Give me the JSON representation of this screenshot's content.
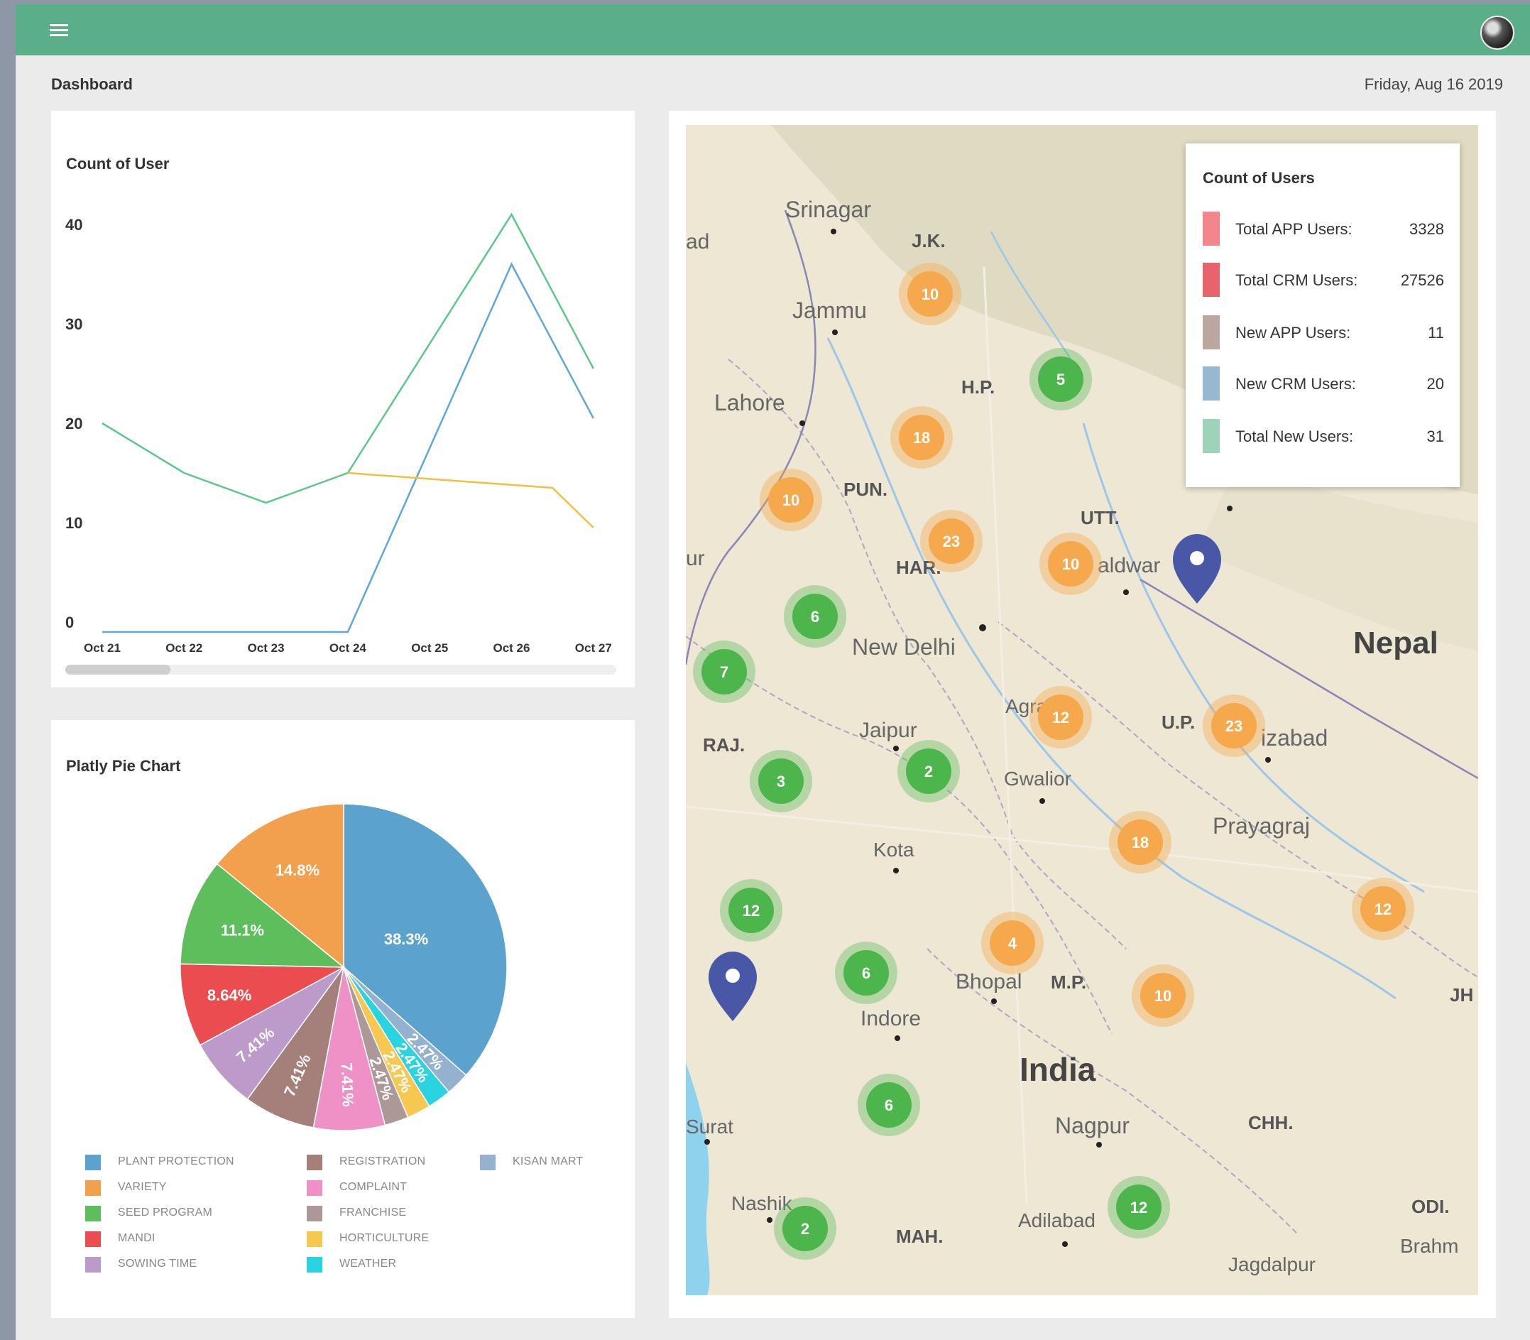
{
  "header": {
    "menu_icon": "hamburger-icon",
    "avatar_icon": "user-avatar-icon"
  },
  "page": {
    "title": "Dashboard",
    "date": "Friday, Aug 16 2019"
  },
  "line_chart": {
    "chart_data": {
      "type": "line",
      "title": "Count of User",
      "x": [
        "Oct 21",
        "Oct 22",
        "Oct 23",
        "Oct 24",
        "Oct 25",
        "Oct 26",
        "Oct 27"
      ],
      "y_ticks": [
        "40",
        "30",
        "20",
        "10",
        "0"
      ],
      "ylim": [
        0,
        40
      ],
      "series": [
        {
          "color": "#5bc888",
          "x": [
            "Oct 21",
            "Oct 22",
            "Oct 23",
            "Oct 24",
            "Oct 26",
            "Oct 27"
          ],
          "values": [
            20,
            15,
            12,
            15,
            41,
            25.5
          ]
        },
        {
          "color": "#5da8d8",
          "x": [
            "Oct 21",
            "Oct 22",
            "Oct 23",
            "Oct 24",
            "Oct 26",
            "Oct 27"
          ],
          "values": [
            -1,
            -1,
            -1,
            -1,
            36,
            20.5
          ]
        },
        {
          "color": "#f2c03e",
          "x": [
            "Oct 24",
            "Oct 26.5",
            "Oct 27"
          ],
          "values": [
            15,
            13.5,
            9.5
          ]
        }
      ],
      "grid": false
    }
  },
  "pie_chart": {
    "chart_data": {
      "type": "pie",
      "title": "Platly Pie Chart",
      "slices": [
        {
          "label": "PLANT PROTECTION",
          "value": 38.3,
          "text": "38.3%",
          "color": "#5ba3ce"
        },
        {
          "label": "KISAN MART",
          "value": 2.47,
          "text": "2.47%",
          "color": "#94b1cf"
        },
        {
          "label": "WEATHER",
          "value": 2.47,
          "text": "2.47%",
          "color": "#2bd3e0"
        },
        {
          "label": "HORTICULTURE",
          "value": 2.47,
          "text": "2.47%",
          "color": "#f6c850"
        },
        {
          "label": "FRANCHISE",
          "value": 2.47,
          "text": "2.47%",
          "color": "#ac9896"
        },
        {
          "label": "COMPLAINT",
          "value": 7.41,
          "text": "7.41%",
          "color": "#ef90c6"
        },
        {
          "label": "REGISTRATION",
          "value": 7.41,
          "text": "7.41%",
          "color": "#a5807b"
        },
        {
          "label": "SOWING TIME",
          "value": 7.41,
          "text": "7.41%",
          "color": "#bc9ac9"
        },
        {
          "label": "MANDI",
          "value": 8.64,
          "text": "8.64%",
          "color": "#ea4c50"
        },
        {
          "label": "SEED PROGRAM",
          "value": 11.1,
          "text": "11.1%",
          "color": "#5cbf5c"
        },
        {
          "label": "VARIETY",
          "value": 14.8,
          "text": "14.8%",
          "color": "#f29f4e"
        }
      ],
      "legend_placement": "bottom",
      "legend": [
        {
          "label": "PLANT PROTECTION",
          "color": "#5ba3ce"
        },
        {
          "label": "VARIETY",
          "color": "#f29f4e"
        },
        {
          "label": "SEED PROGRAM",
          "color": "#5cbf5c"
        },
        {
          "label": "MANDI",
          "color": "#ea4c50"
        },
        {
          "label": "SOWING TIME",
          "color": "#bc9ac9"
        },
        {
          "label": "REGISTRATION",
          "color": "#a5807b"
        },
        {
          "label": "COMPLAINT",
          "color": "#ef90c6"
        },
        {
          "label": "FRANCHISE",
          "color": "#ac9896"
        },
        {
          "label": "HORTICULTURE",
          "color": "#f6c850"
        },
        {
          "label": "WEATHER",
          "color": "#2bd3e0"
        },
        {
          "label": "KISAN MART",
          "color": "#94b1cf"
        }
      ]
    }
  },
  "map": {
    "place_labels": [
      "Srinagar",
      "J.K.",
      "Jammu",
      "H.P.",
      "Lahore",
      "PUN.",
      "UTT.",
      "HAR.",
      "New Delhi",
      "Nepal",
      "Jaipur",
      "U.P.",
      "RAJ.",
      "Gwalior",
      "Prayagraj",
      "Kota",
      "Bhopal",
      "M.P.",
      "Indore",
      "India",
      "Nagpur",
      "CHH.",
      "Surat",
      "Nashik",
      "MAH.",
      "Adilabad",
      "Jagdalpur",
      "ODI.",
      "Brahm",
      "JH",
      "Agra",
      "izabad",
      "aldwar",
      "ad",
      "ur"
    ],
    "orange_clusters": [
      "10",
      "18",
      "10",
      "23",
      "10",
      "12",
      "23",
      "18",
      "12",
      "4",
      "10"
    ],
    "green_clusters": [
      "5",
      "6",
      "7",
      "3",
      "2",
      "12",
      "6",
      "6",
      "12",
      "2"
    ],
    "pin_icon": "map-pin-icon",
    "info": {
      "title": "Count of Users",
      "rows": [
        {
          "label": "Total APP Users:",
          "value": "3328",
          "color": "#f2868c"
        },
        {
          "label": "Total CRM Users:",
          "value": "27526",
          "color": "#e9636c"
        },
        {
          "label": "New APP Users:",
          "value": "11",
          "color": "#bba6a0"
        },
        {
          "label": "New CRM Users:",
          "value": "20",
          "color": "#98b7d0"
        },
        {
          "label": "Total New Users:",
          "value": "31",
          "color": "#9ed3b9"
        }
      ]
    }
  }
}
